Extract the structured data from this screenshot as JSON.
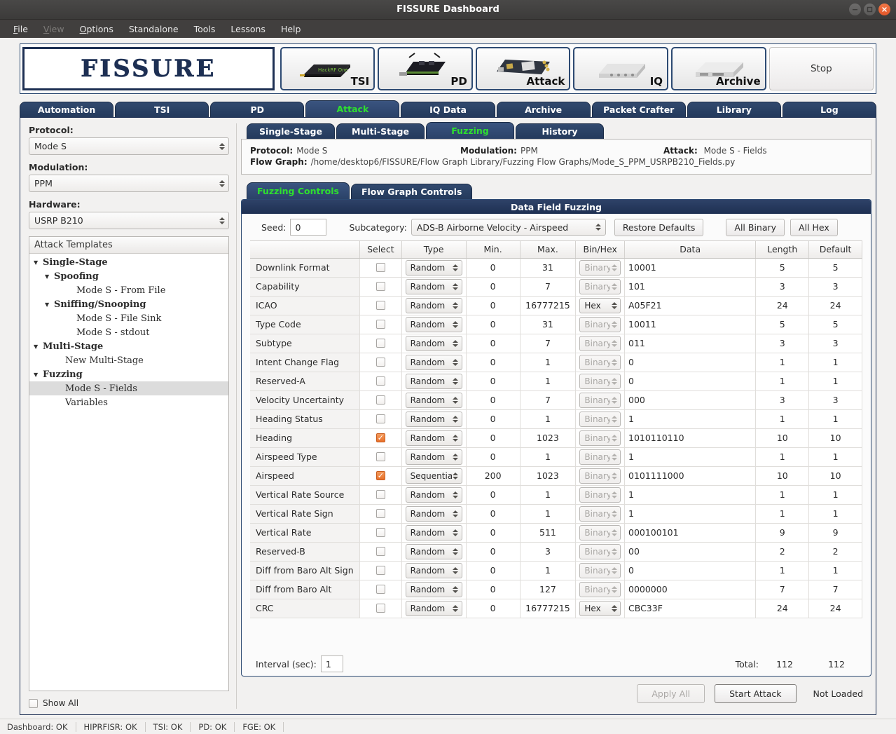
{
  "window": {
    "title": "FISSURE Dashboard",
    "controls": [
      {
        "name": "minimize-button",
        "glyph": "−"
      },
      {
        "name": "maximize-button",
        "glyph": "□"
      },
      {
        "name": "close-button",
        "glyph": "×"
      }
    ]
  },
  "menu": [
    {
      "label": "File",
      "mnemonic": "F",
      "disabled": false
    },
    {
      "label": "View",
      "mnemonic": "V",
      "disabled": true
    },
    {
      "label": "Options",
      "mnemonic": "O",
      "disabled": false
    },
    {
      "label": "Standalone",
      "mnemonic": "",
      "disabled": false
    },
    {
      "label": "Tools",
      "mnemonic": "",
      "disabled": false
    },
    {
      "label": "Lessons",
      "mnemonic": "",
      "disabled": false
    },
    {
      "label": "Help",
      "mnemonic": "",
      "disabled": false
    }
  ],
  "banner": {
    "logo_text": "FISSURE",
    "devices": [
      {
        "label": "TSI",
        "icon": "hackrf-one-device-icon"
      },
      {
        "label": "PD",
        "icon": "usb-sdr-dongle-icon"
      },
      {
        "label": "Attack",
        "icon": "sdr-board-icon"
      },
      {
        "label": "IQ",
        "icon": "usrp-box-icon"
      },
      {
        "label": "Archive",
        "icon": "usrp-box-icon"
      }
    ],
    "stop_label": "Stop"
  },
  "main_tabs": [
    {
      "label": "Automation",
      "active": false
    },
    {
      "label": "TSI",
      "active": false
    },
    {
      "label": "PD",
      "active": false
    },
    {
      "label": "Attack",
      "active": true
    },
    {
      "label": "IQ Data",
      "active": false
    },
    {
      "label": "Archive",
      "active": false
    },
    {
      "label": "Packet Crafter",
      "active": false
    },
    {
      "label": "Library",
      "active": false
    },
    {
      "label": "Log",
      "active": false
    }
  ],
  "sidebar": {
    "protocol_label": "Protocol:",
    "protocol_value": "Mode S",
    "modulation_label": "Modulation:",
    "modulation_value": "PPM",
    "hardware_label": "Hardware:",
    "hardware_value": "USRP B210",
    "tree_header": "Attack Templates",
    "tree": [
      {
        "label": "Single-Stage",
        "indent": 0,
        "arrow": "▼",
        "bold": true,
        "selected": false
      },
      {
        "label": "Spoofing",
        "indent": 1,
        "arrow": "▼",
        "bold": true,
        "selected": false
      },
      {
        "label": "Mode S - From File",
        "indent": 3,
        "arrow": "",
        "bold": false,
        "selected": false
      },
      {
        "label": "Sniffing/Snooping",
        "indent": 1,
        "arrow": "▼",
        "bold": true,
        "selected": false
      },
      {
        "label": "Mode S - File Sink",
        "indent": 3,
        "arrow": "",
        "bold": false,
        "selected": false
      },
      {
        "label": "Mode S - stdout",
        "indent": 3,
        "arrow": "",
        "bold": false,
        "selected": false
      },
      {
        "label": "Multi-Stage",
        "indent": 0,
        "arrow": "▼",
        "bold": true,
        "selected": false
      },
      {
        "label": "New Multi-Stage",
        "indent": 2,
        "arrow": "",
        "bold": false,
        "selected": false
      },
      {
        "label": "Fuzzing",
        "indent": 0,
        "arrow": "▼",
        "bold": true,
        "selected": false
      },
      {
        "label": "Mode S - Fields",
        "indent": 2,
        "arrow": "",
        "bold": false,
        "selected": true
      },
      {
        "label": "Variables",
        "indent": 2,
        "arrow": "",
        "bold": false,
        "selected": false
      }
    ],
    "show_all_label": "Show All",
    "show_all_checked": false
  },
  "sub_tabs": [
    {
      "label": "Single-Stage",
      "active": false
    },
    {
      "label": "Multi-Stage",
      "active": false
    },
    {
      "label": "Fuzzing",
      "active": true
    },
    {
      "label": "History",
      "active": false
    }
  ],
  "info": {
    "protocol_key": "Protocol:",
    "protocol_value": "Mode S",
    "modulation_key": "Modulation:",
    "modulation_value": "PPM",
    "attack_key": "Attack:",
    "attack_value": "Mode S - Fields",
    "flowgraph_key": "Flow Graph:",
    "flowgraph_value": "/home/desktop6/FISSURE/Flow Graph Library/Fuzzing Flow Graphs/Mode_S_PPM_USRPB210_Fields.py"
  },
  "control_tabs": [
    {
      "label": "Fuzzing Controls",
      "active": true
    },
    {
      "label": "Flow Graph Controls",
      "active": false
    }
  ],
  "panel": {
    "title": "Data Field Fuzzing",
    "seed_label": "Seed:",
    "seed_value": "0",
    "subcategory_label": "Subcategory:",
    "subcategory_value": "ADS-B Airborne Velocity - Airspeed",
    "restore_defaults_label": "Restore Defaults",
    "all_binary_label": "All Binary",
    "all_hex_label": "All Hex",
    "columns": [
      "",
      "Select",
      "Type",
      "Min.",
      "Max.",
      "Bin/Hex",
      "Data",
      "Length",
      "Default"
    ],
    "rows": [
      {
        "name": "Downlink Format",
        "selected": false,
        "type": "Random",
        "min": "0",
        "max": "31",
        "binhex": "Binary",
        "binhex_enabled": false,
        "data": "10001",
        "length": "5",
        "default": "5"
      },
      {
        "name": "Capability",
        "selected": false,
        "type": "Random",
        "min": "0",
        "max": "7",
        "binhex": "Binary",
        "binhex_enabled": false,
        "data": "101",
        "length": "3",
        "default": "3"
      },
      {
        "name": "ICAO",
        "selected": false,
        "type": "Random",
        "min": "0",
        "max": "16777215",
        "binhex": "Hex",
        "binhex_enabled": true,
        "data": "A05F21",
        "length": "24",
        "default": "24"
      },
      {
        "name": "Type Code",
        "selected": false,
        "type": "Random",
        "min": "0",
        "max": "31",
        "binhex": "Binary",
        "binhex_enabled": false,
        "data": "10011",
        "length": "5",
        "default": "5"
      },
      {
        "name": "Subtype",
        "selected": false,
        "type": "Random",
        "min": "0",
        "max": "7",
        "binhex": "Binary",
        "binhex_enabled": false,
        "data": "011",
        "length": "3",
        "default": "3"
      },
      {
        "name": "Intent Change Flag",
        "selected": false,
        "type": "Random",
        "min": "0",
        "max": "1",
        "binhex": "Binary",
        "binhex_enabled": false,
        "data": "0",
        "length": "1",
        "default": "1"
      },
      {
        "name": "Reserved-A",
        "selected": false,
        "type": "Random",
        "min": "0",
        "max": "1",
        "binhex": "Binary",
        "binhex_enabled": false,
        "data": "0",
        "length": "1",
        "default": "1"
      },
      {
        "name": "Velocity Uncertainty",
        "selected": false,
        "type": "Random",
        "min": "0",
        "max": "7",
        "binhex": "Binary",
        "binhex_enabled": false,
        "data": "000",
        "length": "3",
        "default": "3"
      },
      {
        "name": "Heading Status",
        "selected": false,
        "type": "Random",
        "min": "0",
        "max": "1",
        "binhex": "Binary",
        "binhex_enabled": false,
        "data": "1",
        "length": "1",
        "default": "1"
      },
      {
        "name": "Heading",
        "selected": true,
        "type": "Random",
        "min": "0",
        "max": "1023",
        "binhex": "Binary",
        "binhex_enabled": false,
        "data": "1010110110",
        "length": "10",
        "default": "10"
      },
      {
        "name": "Airspeed Type",
        "selected": false,
        "type": "Random",
        "min": "0",
        "max": "1",
        "binhex": "Binary",
        "binhex_enabled": false,
        "data": "1",
        "length": "1",
        "default": "1"
      },
      {
        "name": "Airspeed",
        "selected": true,
        "type": "Sequential",
        "min": "200",
        "max": "1023",
        "binhex": "Binary",
        "binhex_enabled": false,
        "data": "0101111000",
        "length": "10",
        "default": "10"
      },
      {
        "name": "Vertical Rate Source",
        "selected": false,
        "type": "Random",
        "min": "0",
        "max": "1",
        "binhex": "Binary",
        "binhex_enabled": false,
        "data": "1",
        "length": "1",
        "default": "1"
      },
      {
        "name": "Vertical Rate Sign",
        "selected": false,
        "type": "Random",
        "min": "0",
        "max": "1",
        "binhex": "Binary",
        "binhex_enabled": false,
        "data": "1",
        "length": "1",
        "default": "1"
      },
      {
        "name": "Vertical Rate",
        "selected": false,
        "type": "Random",
        "min": "0",
        "max": "511",
        "binhex": "Binary",
        "binhex_enabled": false,
        "data": "000100101",
        "length": "9",
        "default": "9"
      },
      {
        "name": "Reserved-B",
        "selected": false,
        "type": "Random",
        "min": "0",
        "max": "3",
        "binhex": "Binary",
        "binhex_enabled": false,
        "data": "00",
        "length": "2",
        "default": "2"
      },
      {
        "name": "Diff from Baro Alt Sign",
        "selected": false,
        "type": "Random",
        "min": "0",
        "max": "1",
        "binhex": "Binary",
        "binhex_enabled": false,
        "data": "0",
        "length": "1",
        "default": "1"
      },
      {
        "name": "Diff from Baro Alt",
        "selected": false,
        "type": "Random",
        "min": "0",
        "max": "127",
        "binhex": "Binary",
        "binhex_enabled": false,
        "data": "0000000",
        "length": "7",
        "default": "7"
      },
      {
        "name": "CRC",
        "selected": false,
        "type": "Random",
        "min": "0",
        "max": "16777215",
        "binhex": "Hex",
        "binhex_enabled": true,
        "data": "CBC33F",
        "length": "24",
        "default": "24"
      }
    ],
    "interval_label": "Interval (sec):",
    "interval_value": "1",
    "total_label": "Total:",
    "total_length": "112",
    "total_default": "112"
  },
  "actions": {
    "apply_all_label": "Apply All",
    "start_attack_label": "Start Attack",
    "status_text": "Not Loaded"
  },
  "statusbar": [
    {
      "label": "Dashboard: OK"
    },
    {
      "label": "HIPRFISR: OK"
    },
    {
      "label": "TSI: OK"
    },
    {
      "label": "PD: OK"
    },
    {
      "label": "FGE: OK"
    }
  ]
}
